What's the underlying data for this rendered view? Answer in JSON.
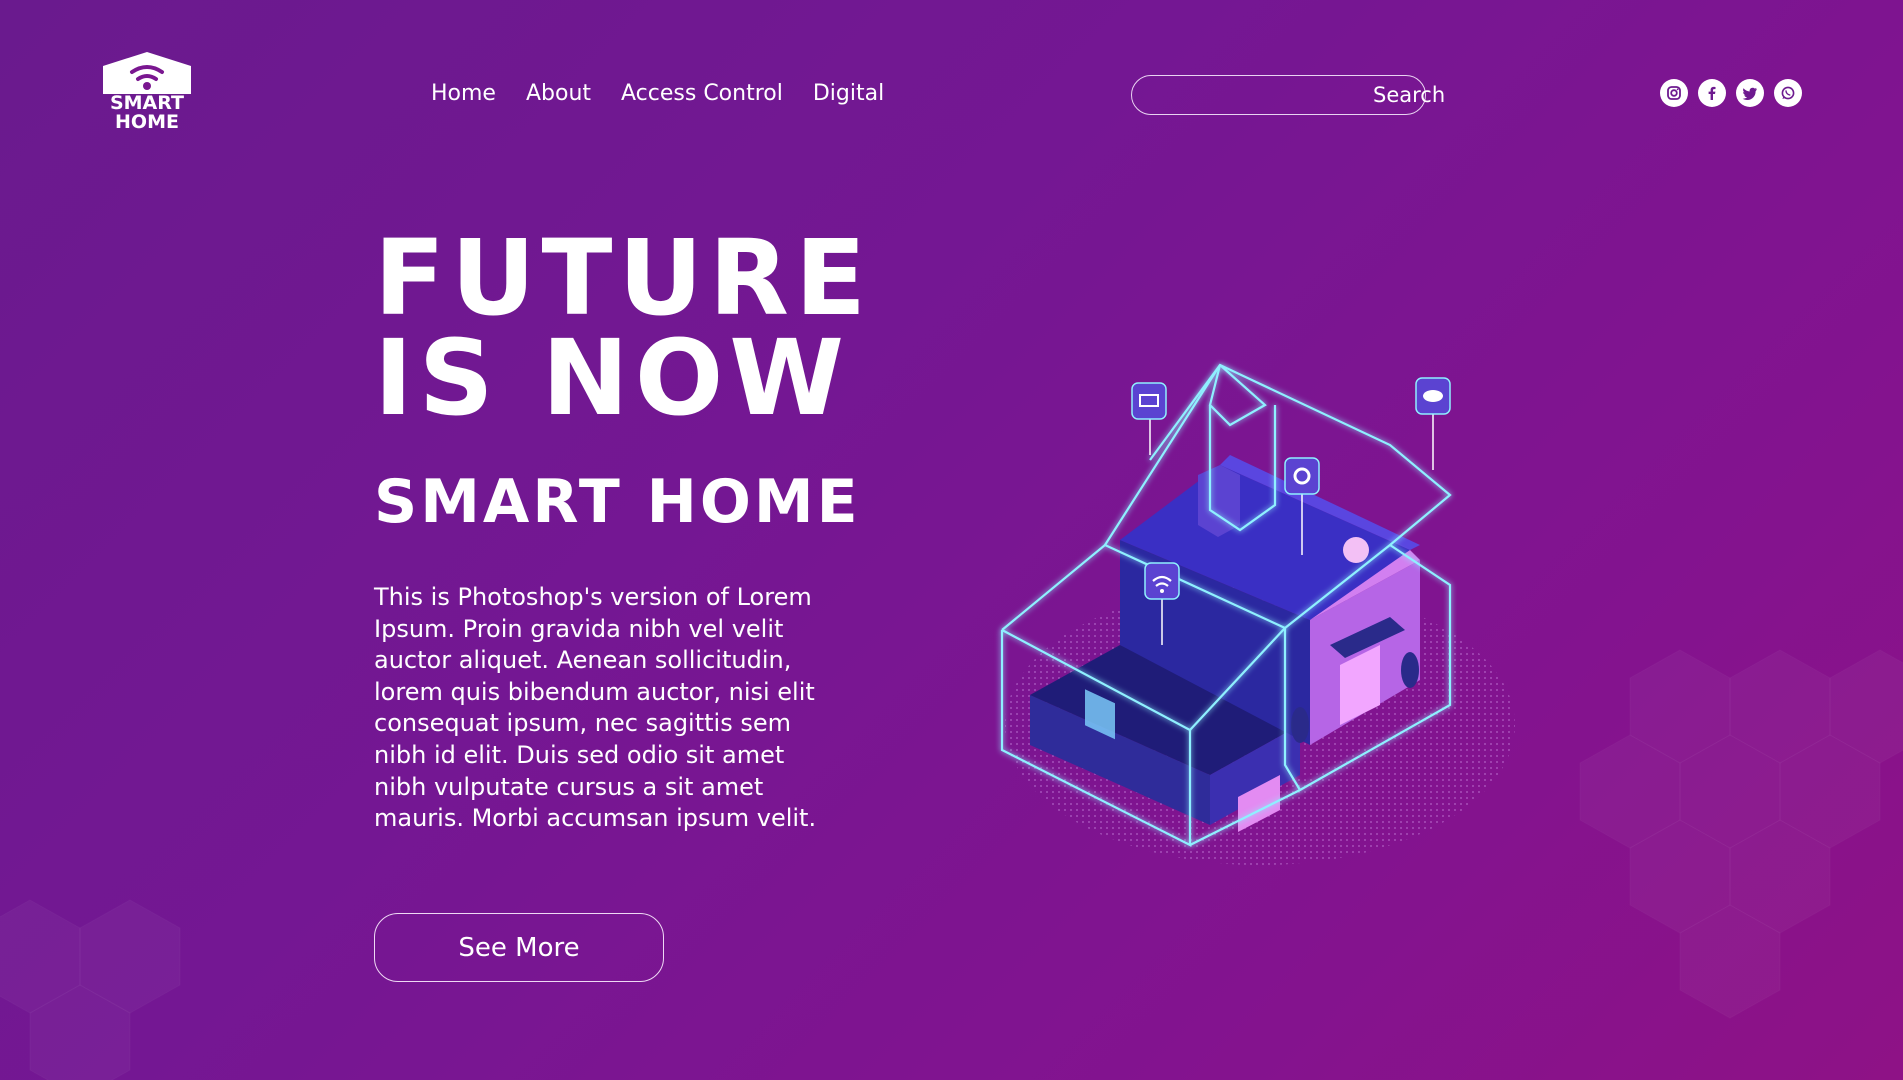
{
  "brand": {
    "logo_line1": "SMART",
    "logo_line2": "HOME"
  },
  "nav": {
    "items": [
      {
        "label": "Home"
      },
      {
        "label": "About"
      },
      {
        "label": "Access Control"
      },
      {
        "label": "Digital"
      }
    ]
  },
  "search": {
    "label": "Search",
    "value": ""
  },
  "social": [
    "instagram-icon",
    "facebook-icon",
    "twitter-icon",
    "whatsapp-icon"
  ],
  "hero": {
    "headline_line1": "FUTURE",
    "headline_line2": "IS NOW",
    "subtitle": "SMART HOME",
    "body": "This is Photoshop's version of Lorem Ipsum. Proin gravida nibh vel velit auctor aliquet. Aenean sollicitudin, lorem quis bibendum auctor, nisi elit consequat ipsum, nec sagittis sem nibh id elit. Duis sed odio sit amet nibh vulputate cursus a sit amet mauris. Morbi accumsan ipsum velit.",
    "cta_label": "See More"
  },
  "colors": {
    "background_start": "#6a1a8e",
    "background_end": "#8e1286",
    "glow": "#7fe8ff",
    "house_dark": "#2a2a8a",
    "house_pink": "#d27ff0"
  }
}
